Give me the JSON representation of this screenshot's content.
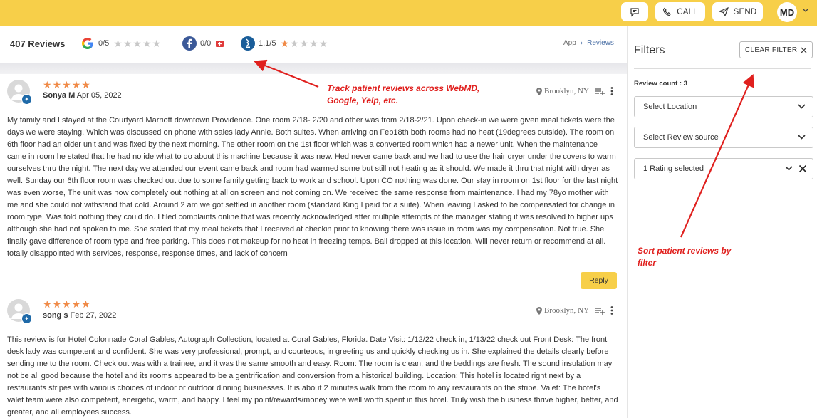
{
  "topbar": {
    "call_label": "CALL",
    "send_label": "SEND",
    "user_initials": "MD",
    "brand_color": "#f7cf49"
  },
  "summary": {
    "total_reviews": "407 Reviews",
    "sources": [
      {
        "name": "google",
        "icon": "google-icon",
        "score": "0/5",
        "stars": 0
      },
      {
        "name": "facebook",
        "icon": "facebook-icon",
        "score": "0/0",
        "stars": null
      },
      {
        "name": "bbb",
        "icon": "bbb-icon",
        "score": "1.1/5",
        "stars": 1
      }
    ]
  },
  "breadcrumb": {
    "root": "App",
    "current": "Reviews"
  },
  "reviews": [
    {
      "rating": 5,
      "author": "Sonya M",
      "date": "Apr 05, 2022",
      "location": "Brooklyn, NY",
      "text": "My family and I stayed at the Courtyard Marriott downtown Providence. One room 2/18- 2/20 and other was from 2/18-2/21. Upon check-in we were given meal tickets were the days we were staying. Which was discussed on phone with sales lady Annie. Both suites. When arriving on Feb18th both rooms had no heat (19degrees outside). The room on 6th floor had an older unit and was fixed by the next morning. The other room on the 1st floor which was a converted room which had a newer unit. When the maintenance came in room he stated that he had no ide what to do about this machine because it was new. Hed never came back and we had to use the hair dryer under the covers to warm ourselves thru the night. The next day we attended our event came back and room had warmed some but still not heating as it should. We made it thru that night with dryer as well. Sunday our 6th floor room was checked out due to some family getting back to work and school. Upon CO nothing was done. Our stay in room on 1st floor for the last night was even worse, The unit was now completely out nothing at all on screen and not coming on. We received the same response from maintenance. I had my 78yo mother with me and she could not withstand that cold. Around 2 am we got settled in another room (standard King I paid for a suite). When leaving I asked to be compensated for change in room type. Was told nothing they could do. I filed complaints online that was recently acknowledged after multiple attempts of the manager stating it was resolved to higher ups although she had not spoken to me. She stated that my meal tickets that I received at checkin prior to knowing there was issue in room was my compensation. Not true. She finally gave difference of room type and free parking. This does not makeup for no heat in freezing temps. Ball dropped at this location. Will never return or recommend at all. totally disappointed with services, response, response times, and lack of concern",
      "reply_label": "Reply"
    },
    {
      "rating": 5,
      "author": "song s",
      "date": "Feb 27, 2022",
      "location": "Brooklyn, NY",
      "text": "This review is for Hotel Colonnade Coral Gables, Autograph Collection, located at Coral Gables, Florida. Date Visit: 1/12/22 check in, 1/13/22 check out Front Desk: The front desk lady was competent and confident. She was very professional, prompt, and courteous, in greeting us and quickly checking us in. She explained the details clearly before sending me to the room. Check out was with a trainee, and it was the same smooth and easy. Room: The room is clean, and the beddings are fresh. The sound insulation may not be all good because the hotel and its rooms appeared to be a gentrification and conversion from a historical building. Location: This hotel is located right next by a restaurants stripes with various choices of indoor or outdoor dinning businesses. It is about 2 minutes walk from the room to any restaurants on the stripe. Valet: The hotel's valet team were also competent, energetic, warm, and happy. I feel my point/rewards/money were well worth spent in this hotel. Truly wish the business thrive higher, better, and greater, and all employees success."
    }
  ],
  "annotations": {
    "track": "Track patient reviews across WebMD, Google, Yelp, etc.",
    "sort": "Sort patient reviews by filter"
  },
  "filters": {
    "title": "Filters",
    "clear_label": "CLEAR FILTER",
    "review_count": "Review count : 3",
    "location_placeholder": "Select Location",
    "source_placeholder": "Select Review source",
    "rating_value": "1 Rating selected"
  }
}
